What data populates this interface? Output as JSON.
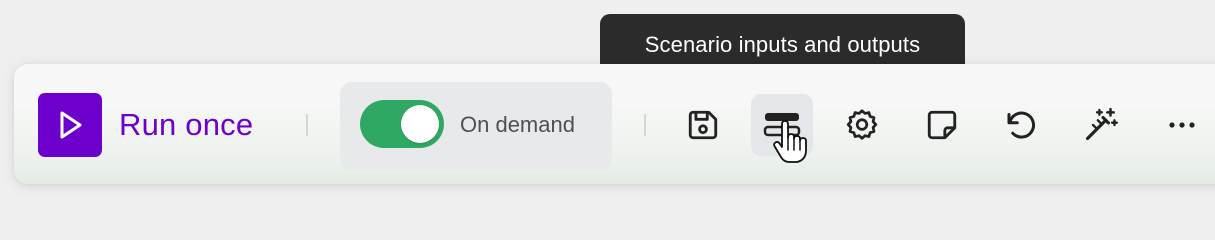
{
  "tooltip": {
    "text": "Scenario inputs and outputs"
  },
  "toolbar": {
    "run_label": "Run once",
    "schedule_label": "On demand",
    "schedule_enabled": true,
    "icons": [
      "play-icon",
      "save-icon",
      "scenario-io-icon",
      "settings-icon",
      "notes-icon",
      "history-icon",
      "magic-wand-icon",
      "more-icon"
    ]
  },
  "colors": {
    "brand": "#6d00cc",
    "toggle_on": "#2ea862",
    "tooltip_bg": "#2b2b2b"
  }
}
